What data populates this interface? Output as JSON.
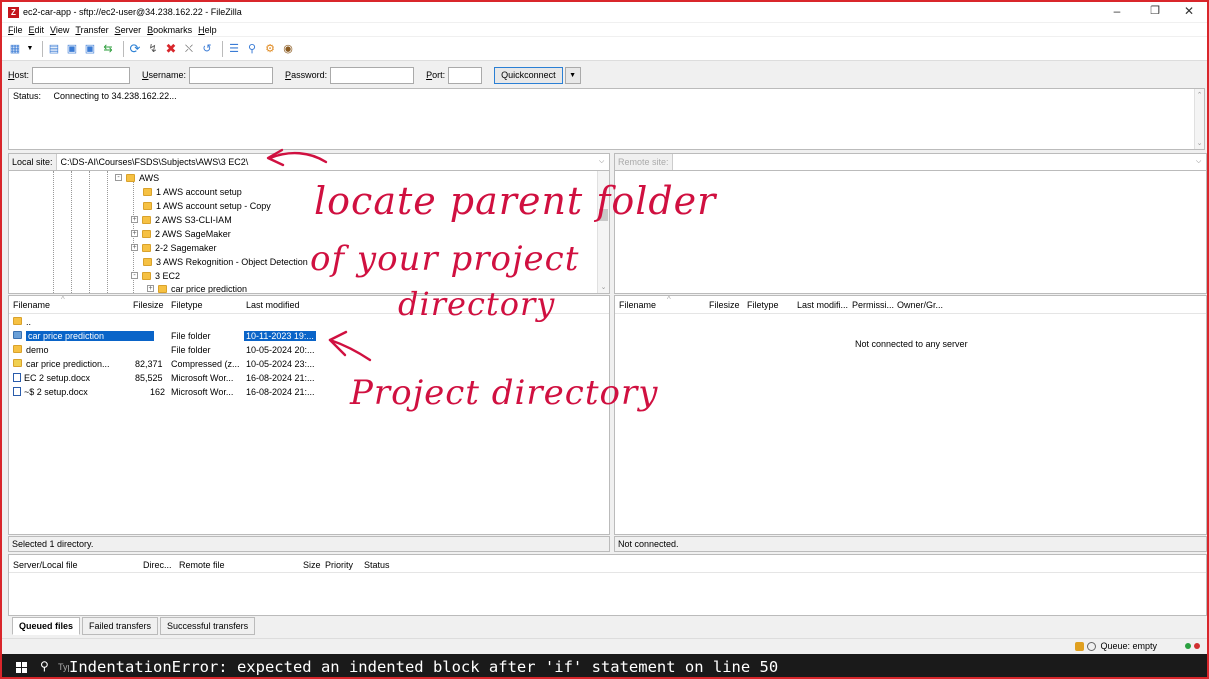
{
  "window": {
    "title": "ec2-car-app - sftp://ec2-user@34.238.162.22 - FileZilla",
    "app_icon_letter": "Z"
  },
  "menu": [
    "File",
    "Edit",
    "View",
    "Transfer",
    "Server",
    "Bookmarks",
    "Help"
  ],
  "quickconnect": {
    "host_label": "Host:",
    "username_label": "Username:",
    "password_label": "Password:",
    "port_label": "Port:",
    "button_label": "Quickconnect",
    "host_value": "",
    "username_value": "",
    "password_value": "",
    "port_value": ""
  },
  "log": [
    {
      "type": "Status:",
      "message": "Connecting to 34.238.162.22..."
    }
  ],
  "local": {
    "site_label": "Local site:",
    "site_path": "C:\\DS-AI\\Courses\\FSDS\\Subjects\\AWS\\3 EC2\\",
    "tree": [
      {
        "label": "AWS",
        "expander": "-"
      },
      {
        "label": "1 AWS account setup",
        "expander": ""
      },
      {
        "label": "1 AWS account setup - Copy",
        "expander": ""
      },
      {
        "label": "2 AWS S3-CLI-IAM",
        "expander": "+"
      },
      {
        "label": "2 AWS SageMaker",
        "expander": "+"
      },
      {
        "label": "2-2 Sagemaker",
        "expander": "+"
      },
      {
        "label": "3 AWS Rekognition - Object Detection",
        "expander": ""
      },
      {
        "label": "3 EC2",
        "expander": "-"
      },
      {
        "label": "car price prediction",
        "expander": "+"
      }
    ],
    "columns": [
      "Filename",
      "Filesize",
      "Filetype",
      "Last modified"
    ],
    "files": [
      {
        "name": "..",
        "size": "",
        "type": "",
        "modified": ""
      },
      {
        "name": "car price prediction",
        "size": "",
        "type": "File folder",
        "modified": "10-11-2023 19:..."
      },
      {
        "name": "demo",
        "size": "",
        "type": "File folder",
        "modified": "10-05-2024 20:..."
      },
      {
        "name": "car price prediction...",
        "size": "82,371",
        "type": "Compressed (z...",
        "modified": "10-05-2024 23:..."
      },
      {
        "name": "EC 2 setup.docx",
        "size": "85,525",
        "type": "Microsoft Wor...",
        "modified": "16-08-2024 21:..."
      },
      {
        "name": "~$ 2 setup.docx",
        "size": "162",
        "type": "Microsoft Wor...",
        "modified": "16-08-2024 21:..."
      }
    ],
    "status": "Selected 1 directory."
  },
  "remote": {
    "site_label": "Remote site:",
    "site_path": "",
    "columns": [
      "Filename",
      "Filesize",
      "Filetype",
      "Last modifi...",
      "Permissi...",
      "Owner/Gr..."
    ],
    "empty_message": "Not connected to any server",
    "status": "Not connected."
  },
  "queue": {
    "columns": [
      "Server/Local file",
      "Direc...",
      "Remote file",
      "Size",
      "Priority",
      "Status"
    ],
    "tabs": [
      "Queued files",
      "Failed transfers",
      "Successful transfers"
    ],
    "status": "Queue: empty"
  },
  "annotations": {
    "line1": "locate parent folder",
    "line2": "of your project",
    "line3": "directory",
    "line4": "Project directory",
    "ink_color": "#d01040"
  },
  "taskbar": {
    "search_typed": "Typ",
    "error_text": "IndentationError: expected an indented block after 'if' statement on line 50"
  },
  "colors": {
    "selection": "#0a64c8",
    "frame_border": "#d9262b",
    "folder": "#f6c143"
  }
}
